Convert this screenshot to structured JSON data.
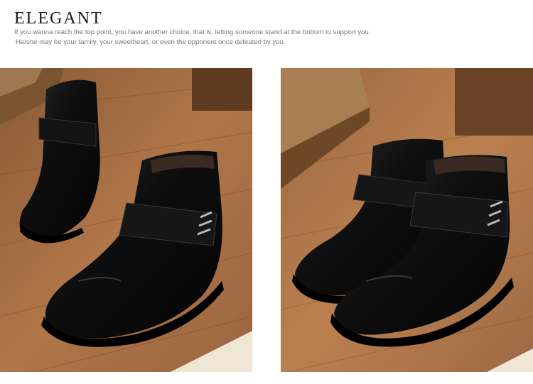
{
  "header": {
    "title": "ELEGANT",
    "description_line1": "If you wanna reach the top point, you have another choice, that is, letting someone stand at the bottom to support you.",
    "description_line2": "He/she may be your family, your sweetheart, or even the opponent once defeated by you."
  },
  "photos": [
    {
      "subject": "pair of black leather ankle boots with strap on wooden floor, angled view"
    },
    {
      "subject": "pair of black leather ankle boots with strap on wooden floor, side view"
    }
  ]
}
